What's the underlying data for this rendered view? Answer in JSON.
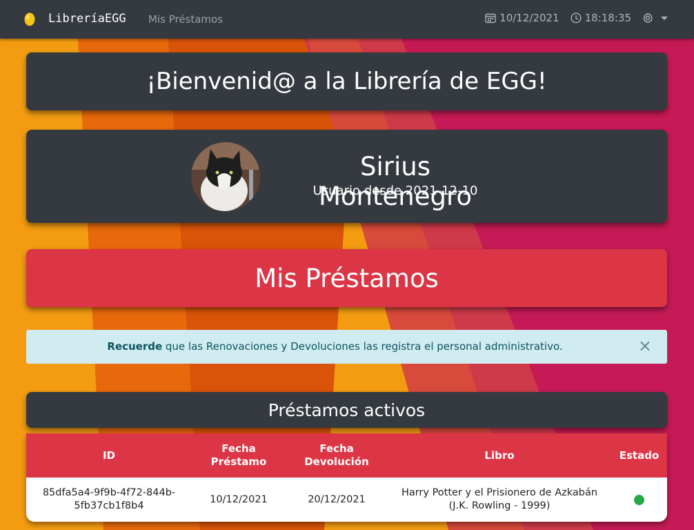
{
  "navbar": {
    "brand": "LibreríaEGG",
    "link": "Mis Préstamos",
    "date": "10/12/2021",
    "time": "18:18:35"
  },
  "welcome": {
    "title": "¡Bienvenid@ a la Librería de EGG!"
  },
  "user": {
    "name": "Sirius Montenegro",
    "since": "Usuario desde 2021-12-10"
  },
  "section": {
    "title": "Mis Préstamos"
  },
  "alert": {
    "strong": "Recuerde",
    "text": " que las Renovaciones y Devoluciones las registra el personal administrativo.",
    "close": "×"
  },
  "loans": {
    "title": "Préstamos activos",
    "headers": {
      "id": "ID",
      "fecha_prestamo_1": "Fecha",
      "fecha_prestamo_2": "Préstamo",
      "fecha_devolucion_1": "Fecha",
      "fecha_devolucion_2": "Devolución",
      "libro": "Libro",
      "estado": "Estado"
    },
    "rows": [
      {
        "id_1": "85dfa5a4-9f9b-4f72-844b-",
        "id_2": "5fb37cb1f8b4",
        "fecha_prestamo": "10/12/2021",
        "fecha_devolucion": "20/12/2021",
        "libro_1": "Harry Potter y el Prisionero de Azkabán",
        "libro_2": "(J.K. Rowling - 1999)",
        "estado_color": "#28a745"
      }
    ]
  },
  "colors": {
    "navbar": "#343a40",
    "accent_red": "#dc3545",
    "alert_bg": "#d1ecf1",
    "alert_text": "#0c5460",
    "status_active": "#28a745"
  },
  "icons": [
    "egg-icon",
    "calendar-icon",
    "clock-icon",
    "gear-icon",
    "chevron-down-icon",
    "close-icon"
  ]
}
